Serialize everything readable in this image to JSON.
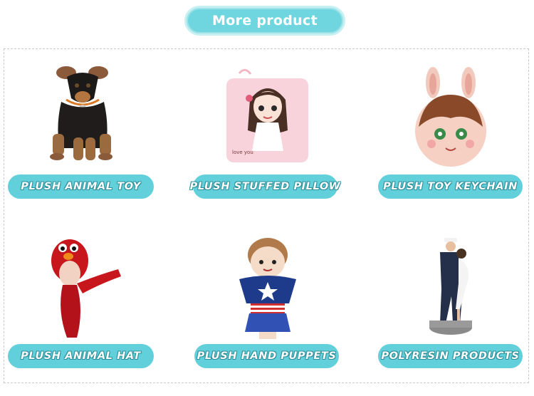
{
  "header": {
    "title": "More product"
  },
  "products": [
    {
      "label": "PLUSH ANIMAL TOY",
      "image": "plush-dog-image"
    },
    {
      "label": "PLUSH STUFFED PILLOW",
      "image": "girl-pillow-image"
    },
    {
      "label": "PLUSH TOY KEYCHAIN",
      "image": "bunny-keychain-image"
    },
    {
      "label": "PLUSH ANIMAL HAT",
      "image": "red-monster-hat-image"
    },
    {
      "label": "PLUSH HAND PUPPETS",
      "image": "hand-puppet-image"
    },
    {
      "label": "POLYRESIN PRODUCTS",
      "image": "sailor-statue-image"
    }
  ],
  "colors": {
    "accent": "#62d0da",
    "accent_light": "#c7f0f3",
    "label_text": "#ffffff"
  }
}
